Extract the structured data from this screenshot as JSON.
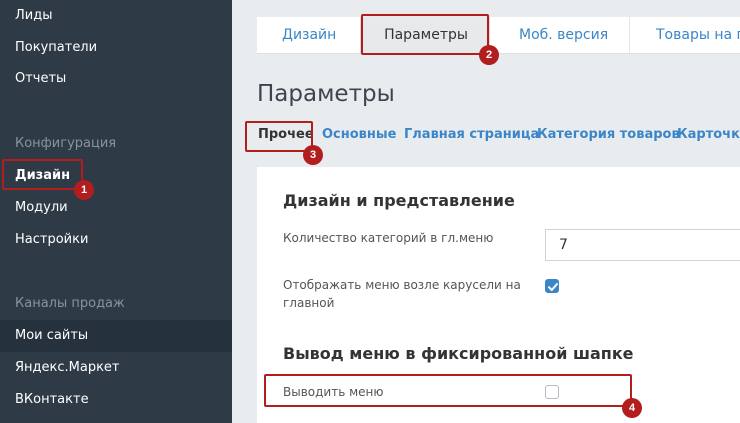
{
  "sidebar": {
    "items_top": [
      "Лиды",
      "Покупатели",
      "Отчеты"
    ],
    "config_heading": "Конфигурация",
    "config_items": [
      "Дизайн",
      "Модули",
      "Настройки"
    ],
    "channels_heading": "Каналы продаж",
    "channels_items": [
      "Мои сайты",
      "Яндекс.Маркет",
      "ВКонтакте"
    ]
  },
  "tabs": {
    "design": "Дизайн",
    "params": "Параметры",
    "mobile": "Моб. версия",
    "goods": "Товары на гл"
  },
  "page_title": "Параметры",
  "subnav": [
    "Прочее",
    "Основные",
    "Главная страница",
    "Категория товаров",
    "Карточка"
  ],
  "section1": {
    "title": "Дизайн и представление",
    "categories_label": "Количество категорий в гл.меню",
    "categories_value": "7",
    "show_menu_label_1": "Отображать меню возле карусели на",
    "show_menu_label_2": "главной",
    "show_menu_checked": true
  },
  "section2": {
    "title": "Вывод меню в фиксированной шапке",
    "output_menu_label": "Выводить меню",
    "output_menu_checked": false
  },
  "annotations": [
    "1",
    "2",
    "3",
    "4"
  ],
  "colors": {
    "sidebar": "#2e3a46",
    "accent": "#3a86c8",
    "annotation": "#b21d1d"
  }
}
